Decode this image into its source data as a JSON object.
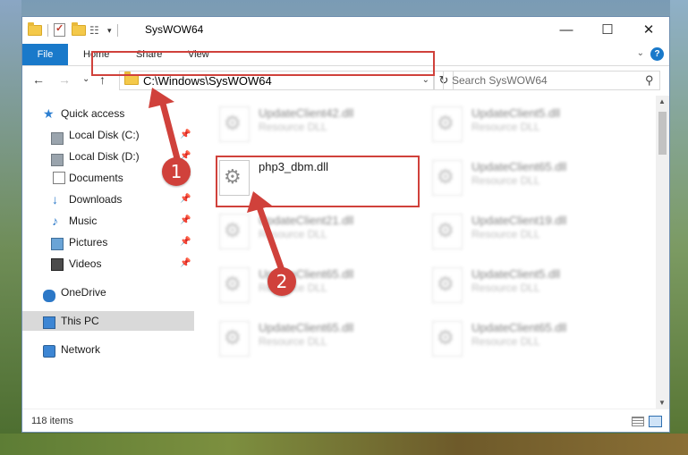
{
  "window": {
    "title": "SysWOW64",
    "minimize_glyph": "—",
    "maximize_glyph": "☐",
    "close_glyph": "✕"
  },
  "ribbon": {
    "tabs": [
      {
        "label": "File"
      },
      {
        "label": "Home"
      },
      {
        "label": "Share"
      },
      {
        "label": "View"
      }
    ],
    "help_glyph": "?",
    "collapse_glyph": "⌄"
  },
  "navigation": {
    "back_glyph": "←",
    "forward_glyph": "→",
    "recent_glyph": "⌄",
    "up_glyph": "↑",
    "address": "C:\\Windows\\SysWOW64",
    "refresh_glyph": "↻",
    "search_placeholder": "Search SysWOW64"
  },
  "sidebar": {
    "items": [
      {
        "label": "Quick access",
        "icon": "star-icon"
      },
      {
        "label": "Local Disk (C:)",
        "icon": "drive-icon",
        "pinned": true
      },
      {
        "label": "Local Disk (D:)",
        "icon": "drive-icon",
        "pinned": true
      },
      {
        "label": "Documents",
        "icon": "documents-icon",
        "pinned": true
      },
      {
        "label": "Downloads",
        "icon": "download-icon",
        "pinned": true
      },
      {
        "label": "Music",
        "icon": "music-icon",
        "pinned": true
      },
      {
        "label": "Pictures",
        "icon": "pictures-icon",
        "pinned": true
      },
      {
        "label": "Videos",
        "icon": "videos-icon",
        "pinned": true
      },
      {
        "label": "OneDrive",
        "icon": "onedrive-icon"
      },
      {
        "label": "This PC",
        "icon": "pc-icon",
        "selected": true
      },
      {
        "label": "Network",
        "icon": "network-icon"
      }
    ],
    "pin_glyph": "📌"
  },
  "files": {
    "left_column": [
      {
        "name": "UpdateClient42.dll",
        "type": "Resource DLL"
      },
      {
        "name": "php3_dbm.dll",
        "type": ""
      },
      {
        "name": "UpdateClient21.dll",
        "type": "Resource DLL"
      },
      {
        "name": "UpdateClient65.dll",
        "type": "Resource DLL"
      },
      {
        "name": "UpdateClient65.dll",
        "type": "Resource DLL"
      }
    ],
    "right_column": [
      {
        "name": "UpdateClient5.dll",
        "type": "Resource DLL"
      },
      {
        "name": "UpdateClient65.dll",
        "type": "Resource DLL"
      },
      {
        "name": "UpdateClient19.dll",
        "type": "Resource DLL"
      },
      {
        "name": "UpdateClient5.dll",
        "type": "Resource DLL"
      },
      {
        "name": "UpdateClient65.dll",
        "type": "Resource DLL"
      }
    ]
  },
  "status": {
    "item_count": "118 items"
  },
  "callouts": [
    {
      "label": "1"
    },
    {
      "label": "2"
    }
  ],
  "colors": {
    "accent": "#1979ca",
    "highlight": "#d0413b"
  }
}
